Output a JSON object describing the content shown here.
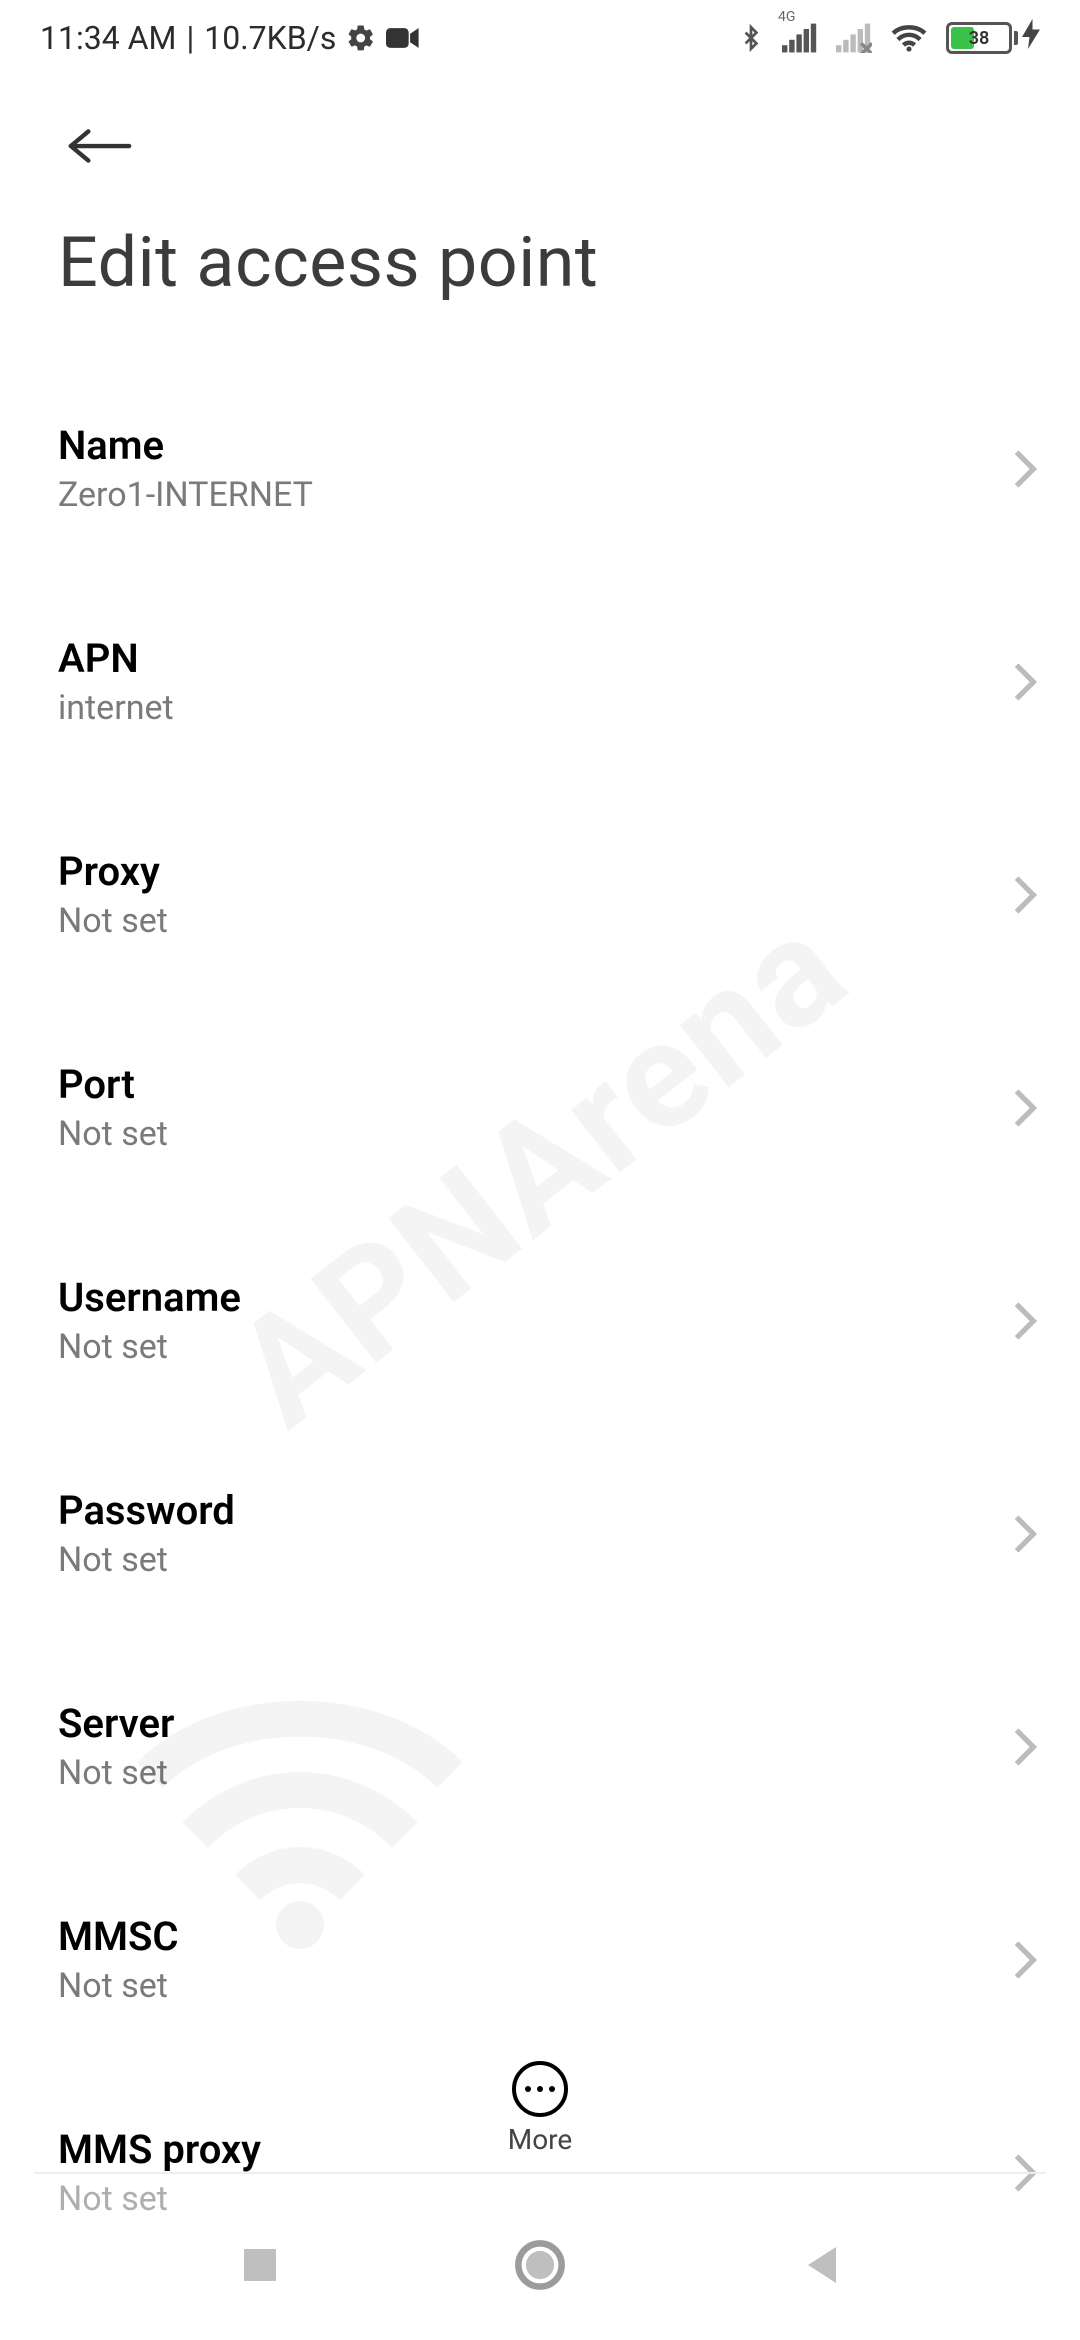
{
  "status": {
    "time": "11:34 AM",
    "speed": "10.7KB/s",
    "net_badge": "4G",
    "battery_percent": "38"
  },
  "page": {
    "title": "Edit access point",
    "more_label": "More"
  },
  "rows": [
    {
      "label": "Name",
      "value": "Zero1-INTERNET"
    },
    {
      "label": "APN",
      "value": "internet"
    },
    {
      "label": "Proxy",
      "value": "Not set"
    },
    {
      "label": "Port",
      "value": "Not set"
    },
    {
      "label": "Username",
      "value": "Not set"
    },
    {
      "label": "Password",
      "value": "Not set"
    },
    {
      "label": "Server",
      "value": "Not set"
    },
    {
      "label": "MMSC",
      "value": "Not set"
    },
    {
      "label": "MMS proxy",
      "value": "Not set"
    }
  ],
  "watermark": "APNArena"
}
